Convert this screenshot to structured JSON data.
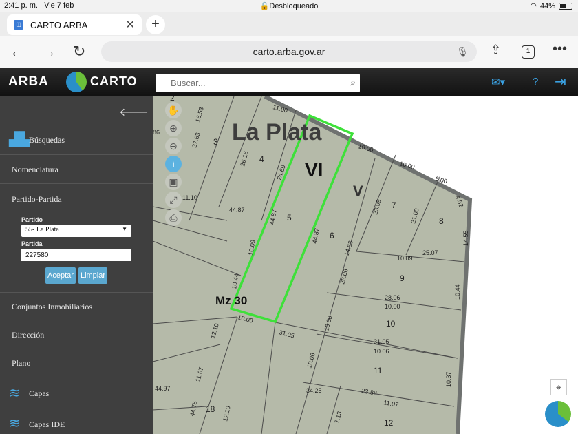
{
  "status": {
    "time": "2:41 p. m.",
    "date": "Vie 7 feb",
    "lock": "Desbloqueado",
    "battery": "44%"
  },
  "browser": {
    "tab_title": "CARTO ARBA",
    "url": "carto.arba.gov.ar",
    "tab_count": "1"
  },
  "header": {
    "brand": "ARBA",
    "app": "CARTO",
    "search_placeholder": "Buscar..."
  },
  "sidebar": {
    "busquedas": "Búsquedas",
    "nomenclatura": "Nomenclatura",
    "partido_partida": "Partido-Partida",
    "partido_label": "Partido",
    "partido_value": "55- La Plata",
    "partida_label": "Partida",
    "partida_value": "227580",
    "aceptar": "Aceptar",
    "limpiar": "Limpiar",
    "conjuntos": "Conjuntos Inmobiliarios",
    "direccion": "Dirección",
    "plano": "Plano",
    "capas": "Capas",
    "capas_ide": "Capas IDE"
  },
  "map": {
    "city": "La Plata",
    "sector_vi": "VI",
    "sector_v": "V",
    "manzana": "Mz 30",
    "parcels": [
      "2",
      "3",
      "4",
      "5",
      "6",
      "7",
      "8",
      "9",
      "10",
      "11",
      "12",
      "18"
    ],
    "dimensions": [
      "11.00",
      "16.53",
      "27.63",
      "26.16",
      "24.69",
      "10.00",
      "10.00",
      "6.00",
      "4.52",
      "23.99",
      "21.00",
      "14.55",
      "11.10",
      "44.87",
      "44.87",
      "44.87",
      "14.63",
      "25.07",
      "10.09",
      "10.09",
      "10.44",
      "28.06",
      "28.06",
      "10.00",
      "10.44",
      "10.00",
      "10.00",
      "31.05",
      "31.05",
      "10.06",
      "12.10",
      "10.06",
      "11.67",
      "10.37",
      "34.25",
      "23.88",
      "11.07",
      "44.97",
      "44.75",
      "12.10",
      "7.13",
      "86"
    ]
  },
  "colors": {
    "highlight": "#3ee03a",
    "map_bg": "#b5baa9",
    "block_fill": "#c3c7b8",
    "street": "#6f7270",
    "sidebar": "#3f3f3f",
    "accent": "#5aa7cf"
  }
}
